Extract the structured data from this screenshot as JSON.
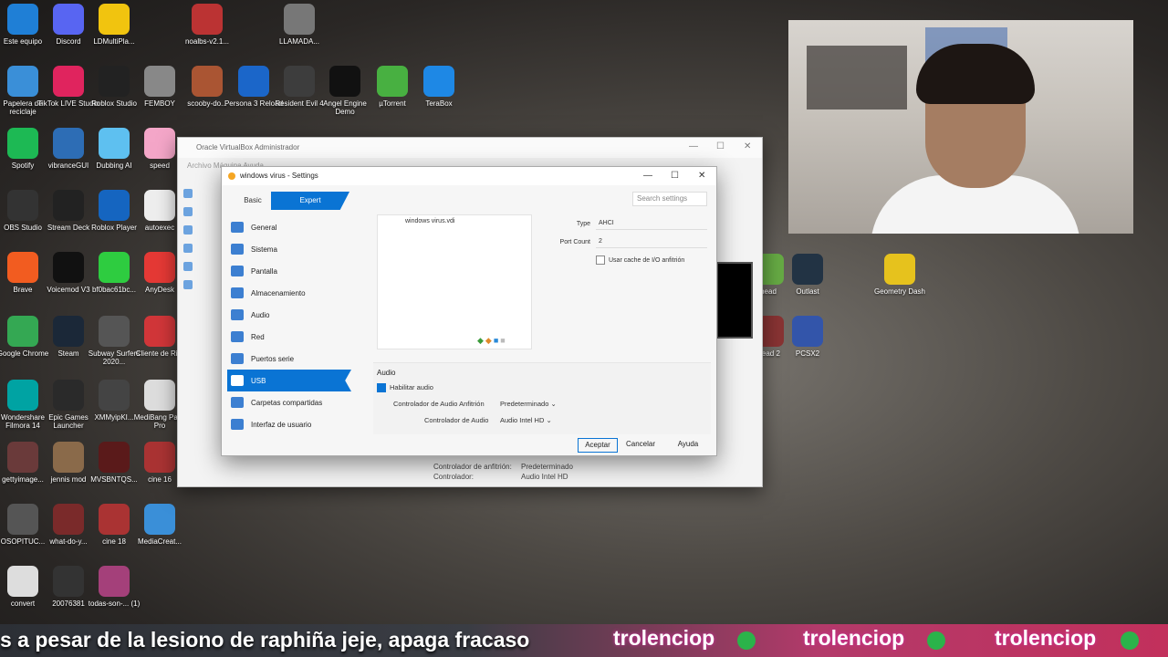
{
  "desktop": {
    "icons": [
      {
        "label": "Este equipo",
        "color": "#1f7fd6"
      },
      {
        "label": "Discord",
        "color": "#5865f2"
      },
      {
        "label": "LDMultiPla...",
        "color": "#f1c40f"
      },
      {
        "label": "noalbs-v2.1...",
        "color": "#b33"
      },
      {
        "label": "LLAMADA...",
        "color": "#777"
      },
      {
        "label": "Papelera de reciclaje",
        "color": "#3a8fd8"
      },
      {
        "label": "TikTok LIVE Studio",
        "color": "#e0245e"
      },
      {
        "label": "Roblox Studio",
        "color": "#222"
      },
      {
        "label": "FEMBOY",
        "color": "#888"
      },
      {
        "label": "scooby-do...",
        "color": "#aa5533"
      },
      {
        "label": "Persona 3 Reload",
        "color": "#1b66c9"
      },
      {
        "label": "Resident Evil 4",
        "color": "#3d3d3d"
      },
      {
        "label": "Angel Engine Demo",
        "color": "#111"
      },
      {
        "label": "µTorrent",
        "color": "#48b041"
      },
      {
        "label": "TeraBox",
        "color": "#1e88e5"
      },
      {
        "label": "Spotify",
        "color": "#1db954"
      },
      {
        "label": "vibranceGUI",
        "color": "#2d6db5"
      },
      {
        "label": "Dubbing AI",
        "color": "#5ec0f0"
      },
      {
        "label": "speed",
        "color": "#f4a6c8"
      },
      {
        "label": "OBS Studio",
        "color": "#333"
      },
      {
        "label": "Stream Deck",
        "color": "#222"
      },
      {
        "label": "Roblox Player",
        "color": "#1565c0"
      },
      {
        "label": "autoexec",
        "color": "#eee"
      },
      {
        "label": "Brave",
        "color": "#f25c20"
      },
      {
        "label": "Voicemod V3",
        "color": "#111"
      },
      {
        "label": "bf0bac61bc...",
        "color": "#2ecc40"
      },
      {
        "label": "AnyDesk",
        "color": "#e53935"
      },
      {
        "label": "Google Chrome",
        "color": "#34a853"
      },
      {
        "label": "Steam",
        "color": "#1b2838"
      },
      {
        "label": "Subway Surfers 2020...",
        "color": "#555"
      },
      {
        "label": "Cliente de Riot",
        "color": "#d13639"
      },
      {
        "label": "Wondershare Filmora 14",
        "color": "#00a3a3"
      },
      {
        "label": "Epic Games Launcher",
        "color": "#2a2a2a"
      },
      {
        "label": "XMMyipKI...",
        "color": "#444"
      },
      {
        "label": "MediBang Paint Pro",
        "color": "#ddd"
      },
      {
        "label": "gettyimage...",
        "color": "#6a3a3a"
      },
      {
        "label": "jennis mod",
        "color": "#8a6a4a"
      },
      {
        "label": "MVSBNTQS...",
        "color": "#5a1a1a"
      },
      {
        "label": "cine 16",
        "color": "#a33"
      },
      {
        "label": "OSOPITUC...",
        "color": "#555"
      },
      {
        "label": "what-do-y...",
        "color": "#7a2a2a"
      },
      {
        "label": "cine 18",
        "color": "#a33"
      },
      {
        "label": "MediaCreat...",
        "color": "#3a8fd8"
      },
      {
        "label": "convert",
        "color": "#ddd"
      },
      {
        "label": "20076381",
        "color": "#333"
      },
      {
        "label": "todas-son-... (1)",
        "color": "#a4407a"
      },
      {
        "label": "Outlast",
        "color": "#234"
      },
      {
        "label": "Geometry Dash",
        "color": "#e6c21d"
      },
      {
        "label": "head",
        "color": "#6a4"
      },
      {
        "label": "PCSX2",
        "color": "#3355aa"
      },
      {
        "label": "Dead 2",
        "color": "#833"
      }
    ]
  },
  "manager": {
    "title": "Oracle VirtualBox Administrador",
    "menu": "Archivo   Máquina   Ayuda",
    "details": [
      {
        "k": "Controlador de anfitrión:",
        "v": "Predeterminado"
      },
      {
        "k": "Controlador:",
        "v": "Audio Intel HD"
      }
    ]
  },
  "settings": {
    "title": "windows virus - Settings",
    "mode_basic": "Basic",
    "mode_expert": "Expert",
    "search_placeholder": "Search settings",
    "nav": [
      "General",
      "Sistema",
      "Pantalla",
      "Almacenamiento",
      "Audio",
      "Red",
      "Puertos serie",
      "USB",
      "Carpetas compartidas",
      "Interfaz de usuario"
    ],
    "active_nav": "USB",
    "storage_item": "windows virus.vdi",
    "type_label": "Type",
    "type_value": "AHCI",
    "port_count_label": "Port Count",
    "port_count_value": "2",
    "host_cache_label": "Usar cache de I/O anfitrión",
    "audio_header": "Audio",
    "enable_audio_label": "Habilitar audio",
    "host_driver_label": "Controlador de Audio Anfitrión",
    "host_driver_value": "Predeterminado",
    "controller_label": "Controlador de Audio",
    "controller_value": "Audio Intel HD",
    "accept": "Aceptar",
    "cancel": "Cancelar",
    "help": "Ayuda"
  },
  "ticker": {
    "message": "s a pesar de la lesiono de raphiña jeje, apaga fracaso",
    "brand": "trolenciop"
  }
}
